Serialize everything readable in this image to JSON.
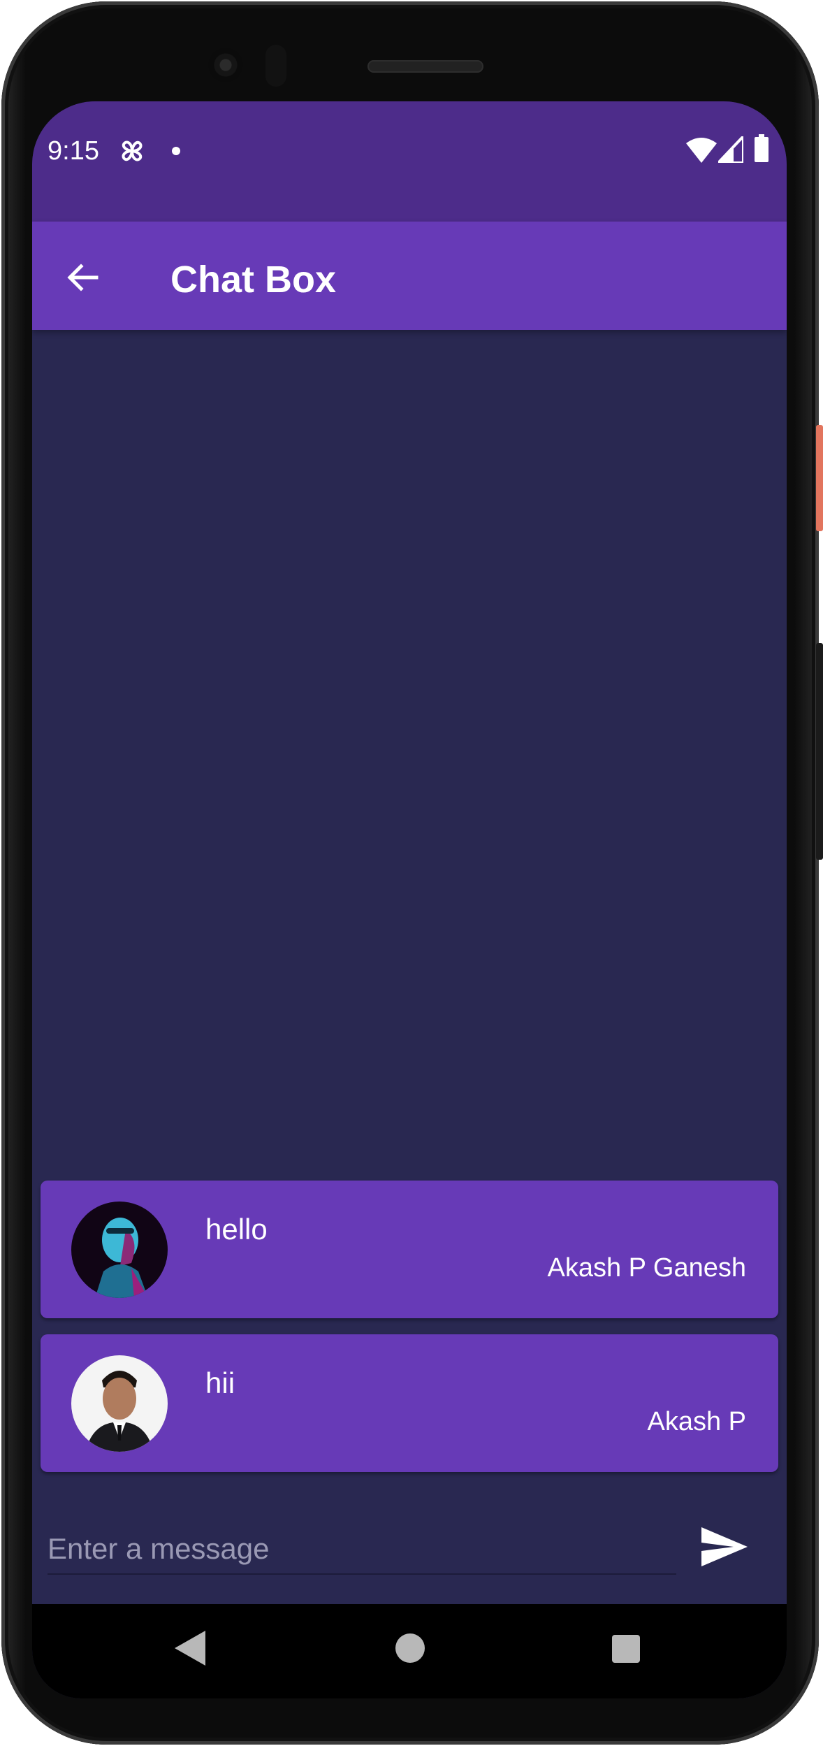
{
  "status_bar": {
    "time": "9:15",
    "icons": [
      "fan-icon",
      "notification-dot-icon",
      "wifi-icon",
      "signal-icon",
      "battery-icon"
    ]
  },
  "app_bar": {
    "title": "Chat Box",
    "back_icon": "arrow-left-icon",
    "background": "#673ab7"
  },
  "messages": [
    {
      "text": "hello",
      "sender": "Akash P Ganesh",
      "avatar": "avatar-photo-neon"
    },
    {
      "text": "hii",
      "sender": "Akash P",
      "avatar": "avatar-photo-suit"
    }
  ],
  "composer": {
    "placeholder": "Enter a message",
    "value": "",
    "send_icon": "send-icon"
  },
  "colors": {
    "status_bar": "#4d2c8a",
    "app_bar": "#673ab7",
    "chat_background": "#292851",
    "card": "#673ab7",
    "text": "#ffffff"
  },
  "nav_bar": {
    "icons": [
      "nav-back-icon",
      "nav-home-icon",
      "nav-recents-icon"
    ]
  }
}
